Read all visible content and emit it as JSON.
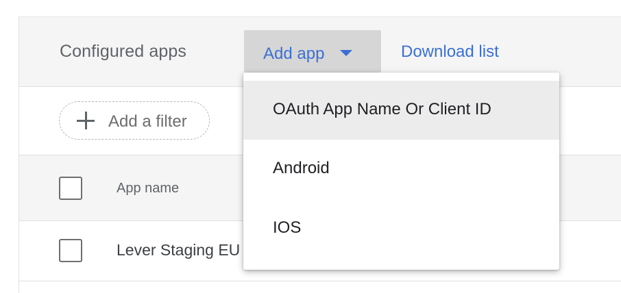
{
  "toolbar": {
    "title": "Configured apps",
    "add_app_label": "Add app",
    "download_label": "Download list"
  },
  "filter": {
    "add_filter_label": "Add a filter"
  },
  "table": {
    "columns": [
      "App name"
    ],
    "rows": [
      {
        "app_name": "Lever Staging EU"
      }
    ]
  },
  "dropdown": {
    "items": [
      {
        "label": "OAuth App Name Or Client ID",
        "highlighted": true
      },
      {
        "label": "Android",
        "highlighted": false
      },
      {
        "label": "IOS",
        "highlighted": false
      }
    ]
  },
  "colors": {
    "accent": "#3b6fd4",
    "toolbar_bg": "#f5f5f5",
    "button_bg": "#d6d6d6"
  },
  "icons": [
    "caret-down-icon",
    "plus-icon"
  ]
}
